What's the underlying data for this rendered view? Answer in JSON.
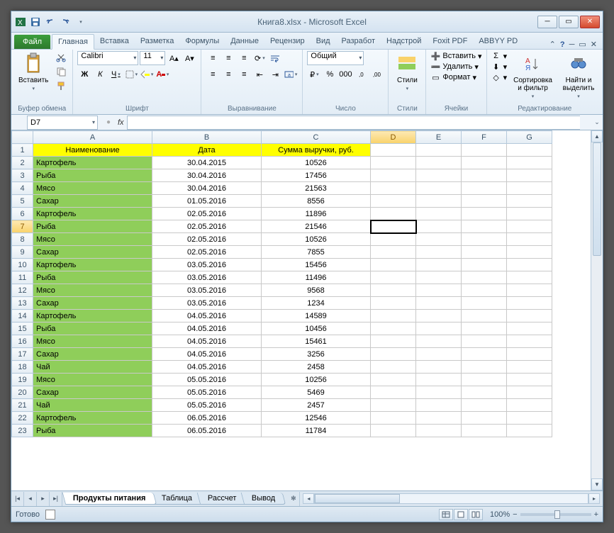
{
  "title": "Книга8.xlsx  -  Microsoft Excel",
  "tabs": {
    "file": "Файл",
    "items": [
      "Главная",
      "Вставка",
      "Разметка",
      "Формулы",
      "Данные",
      "Рецензир",
      "Вид",
      "Разработ",
      "Надстрой",
      "Foxit PDF",
      "ABBYY PD"
    ],
    "active": 0
  },
  "ribbon": {
    "clipboard": {
      "paste": "Вставить",
      "label": "Буфер обмена"
    },
    "font": {
      "name": "Calibri",
      "size": "11",
      "label": "Шрифт",
      "bold": "Ж",
      "italic": "К",
      "underline": "Ч"
    },
    "alignment": {
      "label": "Выравнивание"
    },
    "number": {
      "format": "Общий",
      "label": "Число"
    },
    "styles": {
      "btn": "Стили",
      "label": "Стили"
    },
    "cells": {
      "insert": "Вставить",
      "delete": "Удалить",
      "format": "Формат",
      "label": "Ячейки"
    },
    "editing": {
      "sort": "Сортировка и фильтр",
      "find": "Найти и выделить",
      "label": "Редактирование"
    }
  },
  "namebox": "D7",
  "formula": "",
  "columns": [
    "A",
    "B",
    "C",
    "D",
    "E",
    "F",
    "G"
  ],
  "selected_cell": {
    "col": "D",
    "row": 7
  },
  "headers": [
    "Наименование",
    "Дата",
    "Сумма выручки, руб."
  ],
  "rows": [
    {
      "n": "Картофель",
      "d": "30.04.2015",
      "s": "10526"
    },
    {
      "n": "Рыба",
      "d": "30.04.2016",
      "s": "17456"
    },
    {
      "n": "Мясо",
      "d": "30.04.2016",
      "s": "21563"
    },
    {
      "n": "Сахар",
      "d": "01.05.2016",
      "s": "8556"
    },
    {
      "n": "Картофель",
      "d": "02.05.2016",
      "s": "11896"
    },
    {
      "n": "Рыба",
      "d": "02.05.2016",
      "s": "21546"
    },
    {
      "n": "Мясо",
      "d": "02.05.2016",
      "s": "10526"
    },
    {
      "n": "Сахар",
      "d": "02.05.2016",
      "s": "7855"
    },
    {
      "n": "Картофель",
      "d": "03.05.2016",
      "s": "15456"
    },
    {
      "n": "Рыба",
      "d": "03.05.2016",
      "s": "11496"
    },
    {
      "n": "Мясо",
      "d": "03.05.2016",
      "s": "9568"
    },
    {
      "n": "Сахар",
      "d": "03.05.2016",
      "s": "1234"
    },
    {
      "n": "Картофель",
      "d": "04.05.2016",
      "s": "14589"
    },
    {
      "n": "Рыба",
      "d": "04.05.2016",
      "s": "10456"
    },
    {
      "n": "Мясо",
      "d": "04.05.2016",
      "s": "15461"
    },
    {
      "n": "Сахар",
      "d": "04.05.2016",
      "s": "3256"
    },
    {
      "n": "Чай",
      "d": "04.05.2016",
      "s": "2458"
    },
    {
      "n": "Мясо",
      "d": "05.05.2016",
      "s": "10256"
    },
    {
      "n": "Сахар",
      "d": "05.05.2016",
      "s": "5469"
    },
    {
      "n": "Чай",
      "d": "05.05.2016",
      "s": "2457"
    },
    {
      "n": "Картофель",
      "d": "06.05.2016",
      "s": "12546"
    },
    {
      "n": "Рыба",
      "d": "06.05.2016",
      "s": "11784"
    }
  ],
  "sheets": [
    "Продукты питания",
    "Таблица",
    "Рассчет",
    "Вывод"
  ],
  "active_sheet": 0,
  "status": "Готово",
  "zoom": "100%"
}
